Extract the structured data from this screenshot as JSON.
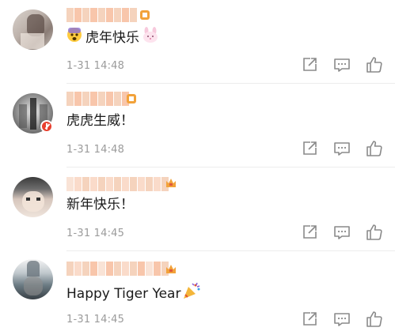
{
  "comments": [
    {
      "content_text": "虎年快乐",
      "time": "1-31 14:48",
      "lead_emoji": "fearful-face-emoji",
      "trail_emoji": "rabbit-face-emoji",
      "avatar_verified": false
    },
    {
      "content_text": "虎虎生威！",
      "time": "1-31 14:48",
      "avatar_verified": true
    },
    {
      "content_text": "新年快乐！",
      "time": "1-31 14:45",
      "avatar_verified": false
    },
    {
      "content_text": "Happy Tiger Year",
      "time": "1-31 14:45",
      "trail_emoji": "party-popper-emoji",
      "avatar_verified": false
    }
  ],
  "icons": {
    "share": "share-icon",
    "reply": "comment-icon",
    "like": "thumbs-up-icon"
  },
  "colors": {
    "time_text": "#9b9b9b",
    "icon_gray": "#8a8a8a",
    "divider": "#ececec",
    "verified_badge": "#e8402f",
    "blurred_name": "#f6b896",
    "level_badge": "#f2a23a"
  }
}
